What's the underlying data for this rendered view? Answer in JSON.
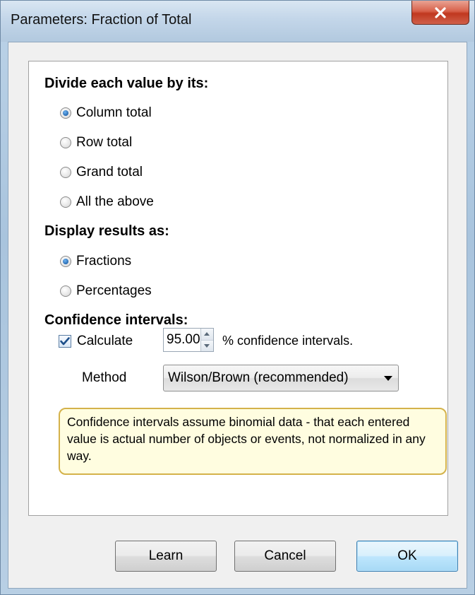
{
  "window": {
    "title": "Parameters: Fraction of Total",
    "close_icon": "close-icon"
  },
  "divide": {
    "heading": "Divide each value by its:",
    "options": [
      {
        "label": "Column total",
        "checked": true
      },
      {
        "label": "Row total",
        "checked": false
      },
      {
        "label": "Grand total",
        "checked": false
      },
      {
        "label": "All the above",
        "checked": false
      }
    ]
  },
  "display": {
    "heading": "Display results as:",
    "options": [
      {
        "label": "Fractions",
        "checked": true
      },
      {
        "label": "Percentages",
        "checked": false
      }
    ]
  },
  "confidence": {
    "heading": "Confidence intervals:",
    "calculate_label": "Calculate",
    "calculate_checked": true,
    "level_value": "95.00",
    "level_suffix": "% confidence intervals.",
    "method_label": "Method",
    "method_value": "Wilson/Brown (recommended)",
    "note": "Confidence intervals assume binomial data - that each entered value is actual number of objects or events, not normalized in any way."
  },
  "buttons": {
    "learn": "Learn",
    "cancel": "Cancel",
    "ok": "OK"
  },
  "colors": {
    "radio_selected": "#1c5fa8",
    "note_background": "#fffde0",
    "note_border": "#d4b24a",
    "close_button": "#c0381f",
    "default_button": "#bee6fd"
  }
}
